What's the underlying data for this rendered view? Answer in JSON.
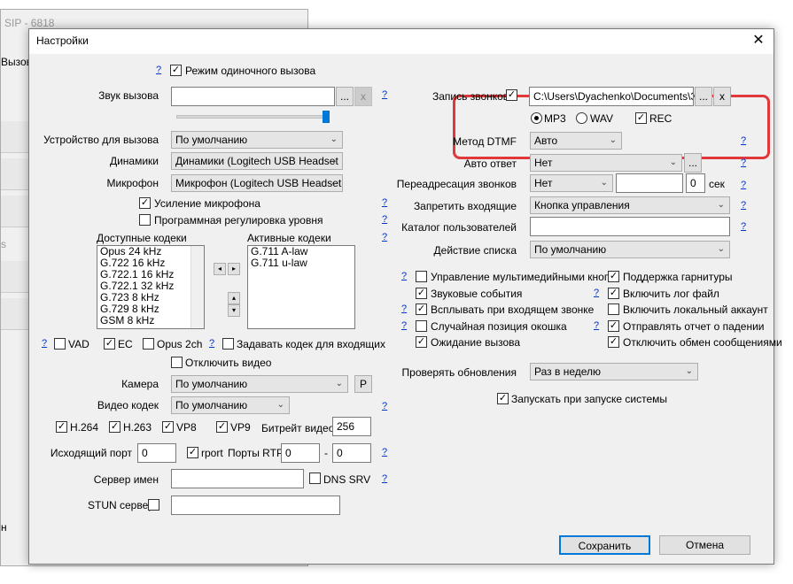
{
  "bg_window": {
    "title_fragment": "SIP - 6818",
    "menu_fragment": "Вызовы",
    "side_fragment": "s",
    "bottom_fragment": "н"
  },
  "dialog": {
    "title": "Настройки"
  },
  "left": {
    "single_call_mode": "Режим одиночного вызова",
    "ring_sound": "Звук вызова",
    "call_device": "Устройство для вызова",
    "call_device_value": "По умолчанию",
    "speakers": "Динамики",
    "speakers_value": "Динамики (Logitech USB Headset",
    "microphone": "Микрофон",
    "microphone_value": "Микрофон (Logitech USB Headset",
    "mic_boost": "Усиление микрофона",
    "software_level": "Программная регулировка уровня",
    "available_codecs": "Доступные кодеки",
    "active_codecs": "Активные кодеки",
    "available_list": [
      "Opus 24 kHz",
      "G.722 16 kHz",
      "G.722.1 16 kHz",
      "G.722.1 32 kHz",
      "G.723 8 kHz",
      "G.729 8 kHz",
      "GSM 8 kHz"
    ],
    "active_list": [
      "G.711 A-law",
      "G.711 u-law"
    ],
    "vad": "VAD",
    "ec": "EC",
    "opus2ch": "Opus 2ch",
    "set_codec_incoming": "Задавать кодек для входящих",
    "disable_video": "Отключить видео",
    "camera": "Камера",
    "camera_value": "По умолчанию",
    "camera_btn": "P",
    "video_codec": "Видео кодек",
    "video_codec_value": "По умолчанию",
    "h264": "H.264",
    "h263": "H.263",
    "vp8": "VP8",
    "vp9": "VP9",
    "video_bitrate": "Битрейт видео",
    "video_bitrate_value": "256",
    "outgoing_port": "Исходящий порт",
    "outgoing_port_value": "0",
    "rport": "rport",
    "rtp_ports": "Порты RTP",
    "rtp_from": "0",
    "rtp_dash": "-",
    "rtp_to": "0",
    "name_server": "Сервер имен",
    "dns_srv": "DNS SRV",
    "stun_server": "STUN сервер",
    "browse": "...",
    "clear": "x",
    "arrow_left": "◂",
    "arrow_right": "▸",
    "arrow_up": "▴",
    "arrow_down": "▾"
  },
  "right": {
    "call_recording": "Запись звонков",
    "record_path": "C:\\Users\\Dyachenko\\Documents\\Зап",
    "mp3": "MP3",
    "wav": "WAV",
    "rec": "REC",
    "dtmf_method": "Метод DTMF",
    "dtmf_value": "Авто",
    "auto_answer": "Авто ответ",
    "auto_answer_value": "Нет",
    "call_forward": "Переадресация звонков",
    "call_forward_value": "Нет",
    "forward_delay": "0",
    "sec": "сек",
    "block_incoming": "Запретить входящие",
    "block_incoming_value": "Кнопка управления",
    "user_catalog": "Каталог пользователей",
    "list_action": "Действие списка",
    "list_action_value": "По умолчанию",
    "checks": [
      {
        "label": "Управление мультимедийными кнопк",
        "checked": false
      },
      {
        "label": "Звуковые события",
        "checked": true
      },
      {
        "label": "Всплывать при входящем звонке",
        "checked": true
      },
      {
        "label": "Случайная позиция окошка",
        "checked": false
      },
      {
        "label": "Ожидание вызова",
        "checked": true
      }
    ],
    "checks2": [
      {
        "label": "Поддержка гарнитуры",
        "checked": true
      },
      {
        "label": "Включить лог файл",
        "checked": true
      },
      {
        "label": "Включить локальный аккаунт",
        "checked": false
      },
      {
        "label": "Отправлять отчет о падении",
        "checked": true
      },
      {
        "label": "Отключить обмен сообщениями",
        "checked": true
      }
    ],
    "check_updates": "Проверять обновления",
    "check_updates_value": "Раз в неделю",
    "autostart": "Запускать при запуске системы"
  },
  "buttons": {
    "save": "Сохранить",
    "cancel": "Отмена"
  },
  "help": "?",
  "check_mark": "✓",
  "chevron": "⌄",
  "close": "✕"
}
